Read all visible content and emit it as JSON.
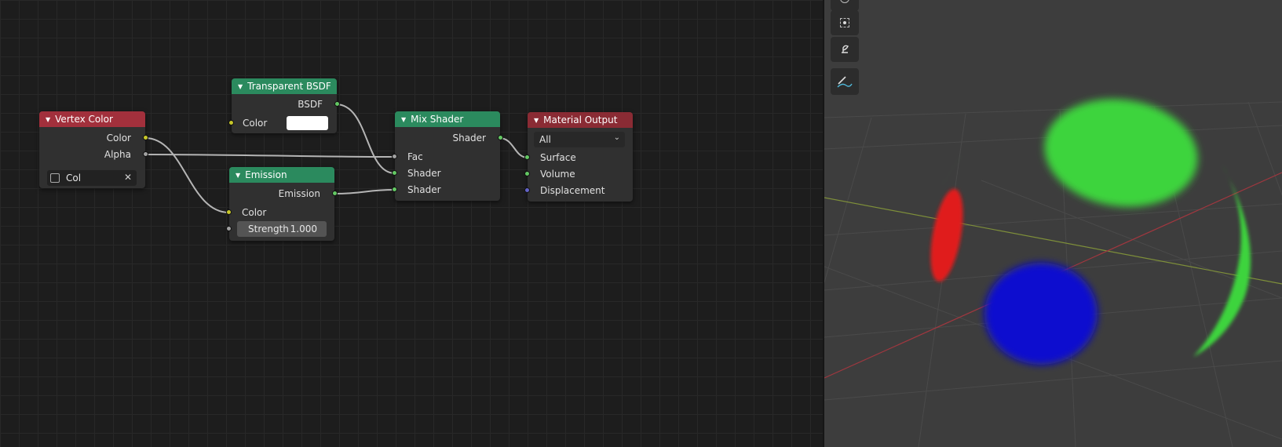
{
  "node_editor": {
    "nodes": {
      "vertex_color": {
        "title": "Vertex Color",
        "outputs": [
          "Color",
          "Alpha"
        ],
        "layer_field": "Col"
      },
      "transparent_bsdf": {
        "title": "Transparent BSDF",
        "output": "BSDF",
        "input_color": "Color",
        "color_swatch": "#ffffff"
      },
      "emission": {
        "title": "Emission",
        "output": "Emission",
        "input_color": "Color",
        "strength_label": "Strength",
        "strength_value": "1.000"
      },
      "mix_shader": {
        "title": "Mix Shader",
        "output": "Shader",
        "inputs": [
          "Fac",
          "Shader",
          "Shader"
        ]
      },
      "material_output": {
        "title": "Material Output",
        "target": "All",
        "inputs": [
          "Surface",
          "Volume",
          "Displacement"
        ]
      }
    }
  },
  "colors": {
    "header_red": "#a2303c",
    "header_green": "#2b8a5e",
    "header_maroon": "#8a2b34",
    "socket_color": "#c7c729",
    "socket_float": "#a1a1a1",
    "socket_shader": "#63c763",
    "socket_vector": "#6363c7"
  },
  "viewport": {
    "tools": [
      "cursor-icon",
      "move-icon",
      "annotate-icon"
    ],
    "blobs": [
      "green",
      "red",
      "blue",
      "green"
    ]
  }
}
